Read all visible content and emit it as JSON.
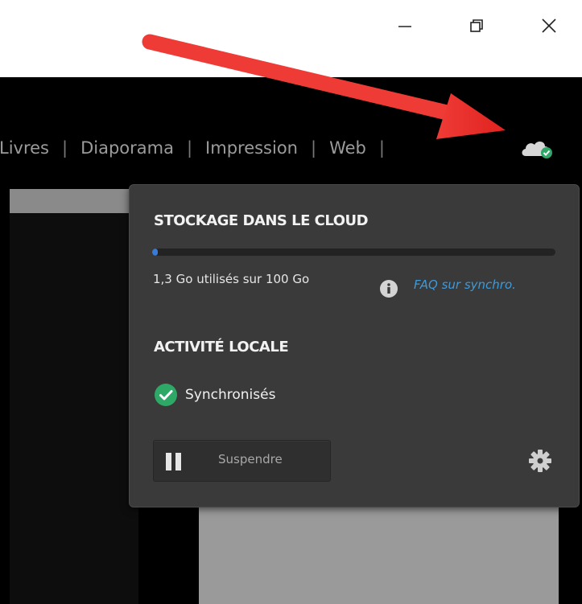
{
  "window": {
    "minimize_icon": "minimize-icon",
    "restore_icon": "restore-icon",
    "close_icon": "close-icon"
  },
  "modules": {
    "items": [
      "Livres",
      "Diaporama",
      "Impression",
      "Web"
    ],
    "separator": "|",
    "cloud_icon": "cloud-sync-status-icon"
  },
  "popup": {
    "storage_title": "STOCKAGE DANS LE CLOUD",
    "storage_used_fraction": 0.013,
    "usage_text": "1,3 Go utilisés sur 100 Go",
    "info_icon": "info-icon",
    "faq_link": "FAQ sur synchro.",
    "local_title": "ACTIVITÉ LOCALE",
    "sync_status": "Synchronisés",
    "sync_status_icon": "check-circle-icon",
    "pause_button": "Suspendre",
    "pause_icon": "pause-icon",
    "settings_icon": "gear-icon"
  },
  "colors": {
    "accent_link": "#3e9ad8",
    "progress": "#3a7bd5",
    "sync_ok": "#2ea866",
    "annotation_arrow": "#e8322e"
  }
}
